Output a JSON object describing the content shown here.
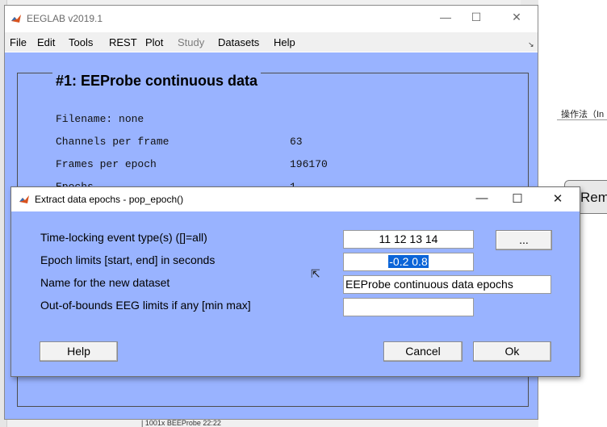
{
  "main_window": {
    "title": "EEGLAB v2019.1",
    "controls": {
      "minimize": "—",
      "maximize": "☐",
      "close": "✕"
    },
    "menu": [
      "File",
      "Edit",
      "Tools",
      "REST",
      "Plot",
      "Study",
      "Datasets",
      "Help"
    ],
    "menu_corner": "↘",
    "dataset_title": "#1: EEProbe continuous data",
    "info": [
      {
        "label": "Filename: none",
        "value": ""
      },
      {
        "label": "Channels per frame",
        "value": "63"
      },
      {
        "label": "Frames per epoch",
        "value": "196170"
      },
      {
        "label": "Epochs",
        "value": "1"
      }
    ]
  },
  "dialog": {
    "title": "Extract data epochs - pop_epoch()",
    "controls": {
      "minimize": "—",
      "maximize": "☐",
      "close": "✕"
    },
    "fields": [
      {
        "label": "Time-locking event type(s) ([]=all)",
        "value": "11 12 13 14"
      },
      {
        "label": "Epoch limits [start, end] in seconds",
        "value": "-0.2 0.8"
      },
      {
        "label": "Name for the new dataset",
        "value": "EEProbe continuous data epochs"
      },
      {
        "label": "Out-of-bounds EEG limits if any [min max]",
        "value": ""
      }
    ],
    "browse_label": "...",
    "help_label": "Help",
    "cancel_label": "Cancel",
    "ok_label": "Ok"
  },
  "background": {
    "right_text": "操作法（In",
    "rem_button": "Rem",
    "bottom_text": "| 1001x BEEProbe 22:22"
  },
  "colors": {
    "panel_bg": "#99b3ff",
    "selection": "#0a64d8"
  }
}
